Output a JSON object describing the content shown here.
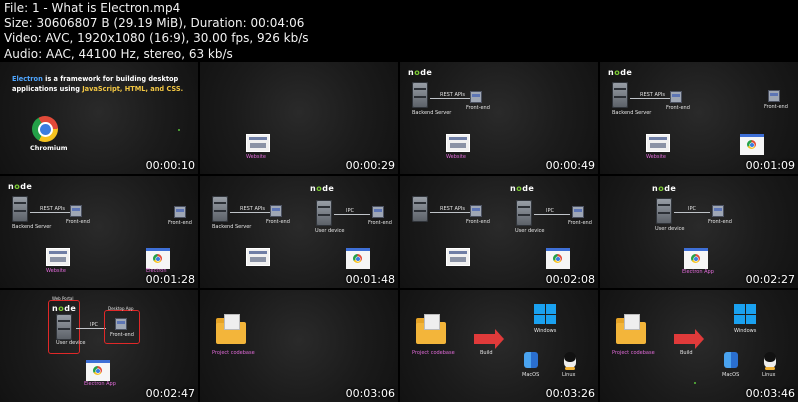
{
  "header": {
    "file": "File: 1 - What is Electron.mp4",
    "size": "Size: 30606807 B (29.19 MiB), Duration: 00:04:06",
    "video": "Video: AVC, 1920x1080 (16:9), 30.00 fps, 926 kb/s",
    "audio": "Audio: AAC, 44100 Hz, stereo, 63 kb/s"
  },
  "intro_text": {
    "p1": "Electron",
    "p2": " is a framework for building desktop applications using ",
    "p3": "JavaScript, HTML, and CSS.",
    "chromium": "Chromium"
  },
  "labels": {
    "rest": "REST APIs",
    "backend": "Backend Server",
    "frontend": "Front-end",
    "website": "Website",
    "electron": "Electron",
    "electron_app": "Electron App",
    "ipc": "IPC",
    "user_device": "User device",
    "node": "node",
    "project": "Project codebase",
    "build": "Build",
    "windows": "Windows",
    "macos": "MacOS",
    "linux": "Linux",
    "web_portal": "Web Portal",
    "desktop_app": "Desktop App"
  },
  "timestamps": [
    "00:00:10",
    "00:00:29",
    "00:00:49",
    "00:01:09",
    "00:01:28",
    "00:01:48",
    "00:02:08",
    "00:02:27",
    "00:02:47",
    "00:03:06",
    "00:03:26",
    "00:03:46"
  ],
  "colors": {
    "background": "#000000",
    "node_green": "#7dcd35",
    "electron_blue": "#4fa6ff",
    "highlight_yellow": "#f2c744",
    "label_magenta": "#e06ad8"
  }
}
